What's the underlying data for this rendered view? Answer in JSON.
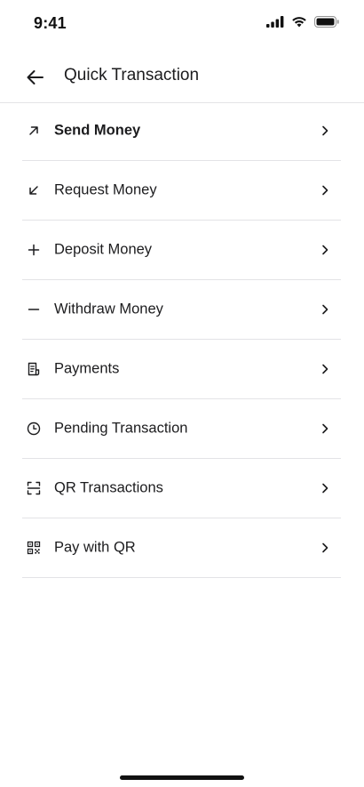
{
  "status_bar": {
    "time": "9:41"
  },
  "header": {
    "title": "Quick Transaction"
  },
  "menu": [
    {
      "label": "Send Money",
      "icon": "arrow-up-right-icon"
    },
    {
      "label": "Request Money",
      "icon": "arrow-down-left-icon"
    },
    {
      "label": "Deposit Money",
      "icon": "plus-icon"
    },
    {
      "label": "Withdraw Money",
      "icon": "minus-icon"
    },
    {
      "label": "Payments",
      "icon": "receipt-icon"
    },
    {
      "label": "Pending Transaction",
      "icon": "clock-icon"
    },
    {
      "label": "QR Transactions",
      "icon": "scan-frame-icon"
    },
    {
      "label": "Pay with QR",
      "icon": "qr-code-icon"
    }
  ],
  "colors": {
    "text": "#1c1c1e",
    "divider": "#e3e3e6",
    "background": "#ffffff"
  }
}
